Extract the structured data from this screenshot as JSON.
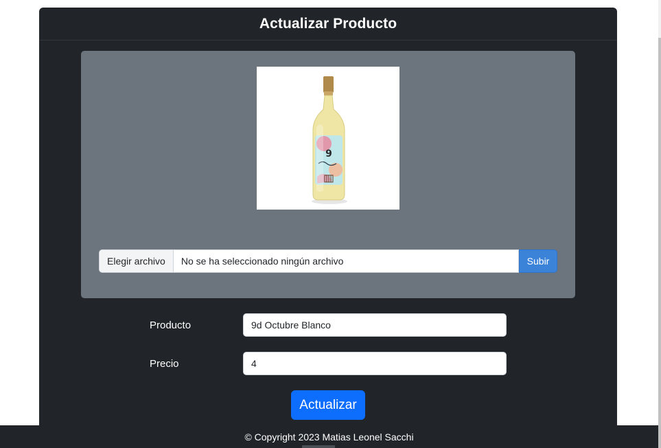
{
  "header": {
    "title": "Actualizar Producto"
  },
  "image": {
    "alt": "9d Octubre Blanco"
  },
  "upload": {
    "choose_label": "Elegir archivo",
    "status_text": "No se ha seleccionado ningún archivo",
    "button_label": "Subir"
  },
  "form": {
    "product_label": "Producto",
    "product_value": "9d Octubre Blanco",
    "price_label": "Precio",
    "price_value": "4",
    "submit_label": "Actualizar"
  },
  "footer": {
    "copyright": "© Copyright 2023 Matias Leonel Sacchi"
  },
  "colors": {
    "card_bg": "#212529",
    "panel_bg": "#6c757d",
    "primary": "#0d6efd",
    "upload_button": "#3b82d9"
  }
}
